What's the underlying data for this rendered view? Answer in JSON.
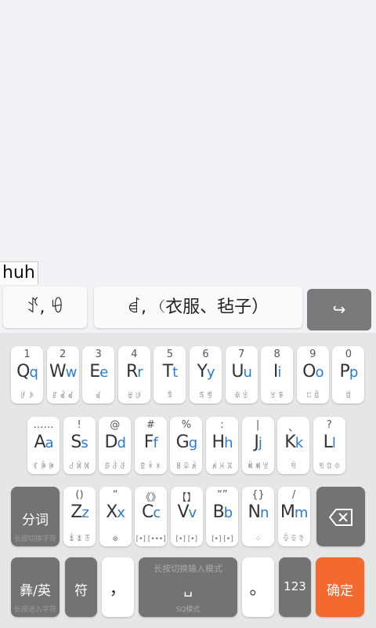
{
  "composing": "huh",
  "candidates": [
    "ꀋ, ꀺ",
    "ꀸ, （衣服、毡子）"
  ],
  "expand_symbol": "↪",
  "rows": {
    "row1": [
      {
        "sym": "1",
        "up": "Q",
        "lo": "q",
        "yi": "ꀱ ꀲ"
      },
      {
        "sym": "2",
        "up": "W",
        "lo": "w",
        "yi": "ꀵ ꀶ ꀷ"
      },
      {
        "sym": "3",
        "up": "E",
        "lo": "e",
        "yi": "ꀸ"
      },
      {
        "sym": "4",
        "up": "R",
        "lo": "r",
        "yi": "ꁁ ꁂ"
      },
      {
        "sym": "5",
        "up": "T",
        "lo": "t",
        "yi": "ꁃ"
      },
      {
        "sym": "6",
        "up": "Y",
        "lo": "y",
        "yi": "ꁄ ꁅ"
      },
      {
        "sym": "7",
        "up": "U",
        "lo": "u",
        "yi": "ꁆ ꁇ"
      },
      {
        "sym": "8",
        "up": "I",
        "lo": "i",
        "yi": "ꁈ ꁉ"
      },
      {
        "sym": "9",
        "up": "O",
        "lo": "o",
        "yi": "ꁊ ꁋ"
      },
      {
        "sym": "0",
        "up": "P",
        "lo": "p",
        "yi": "ꁌ"
      }
    ],
    "row2": [
      {
        "sym": "……",
        "up": "A",
        "lo": "a",
        "yi": "ꁍ ꁎ ꁏ"
      },
      {
        "sym": "!",
        "up": "S",
        "lo": "s",
        "yi": "ꁐ ꁑ ꁒ"
      },
      {
        "sym": "@",
        "up": "D",
        "lo": "d",
        "yi": "ꁓ ꁔ ꁕ"
      },
      {
        "sym": "#",
        "up": "F",
        "lo": "f",
        "yi": "ꁖ ꁗ ꁘ"
      },
      {
        "sym": "%",
        "up": "G",
        "lo": "g",
        "yi": "ꁙ ꁚ ꁛ"
      },
      {
        "sym": ":",
        "up": "H",
        "lo": "h",
        "yi": "ꁜ ꁝ ꁞ"
      },
      {
        "sym": "|",
        "up": "J",
        "lo": "j",
        "yi": "ꁟ ꁠ ꁡ"
      },
      {
        "sym": "、",
        "up": "K",
        "lo": "k",
        "yi": "ꁢ"
      },
      {
        "sym": "?",
        "up": "L",
        "lo": "l",
        "yi": "ꁣ ꁤ ꁥ"
      }
    ],
    "row3": [
      {
        "sym": "()",
        "up": "Z",
        "lo": "z",
        "yi": "ꁦ ꁧ ꁨ"
      },
      {
        "sym": "“",
        "up": "X",
        "lo": "x",
        "yi": "⊗"
      },
      {
        "sym": "《》",
        "up": "C",
        "lo": "c",
        "yi": "[•] [•••]"
      },
      {
        "sym": "【】",
        "up": "V",
        "lo": "v",
        "yi": "[•] [•]"
      },
      {
        "sym": "“”",
        "up": "B",
        "lo": "b",
        "yi": "[•] [•]"
      },
      {
        "sym": "{}",
        "up": "N",
        "lo": "n",
        "yi": "⁘"
      },
      {
        "sym": "/",
        "up": "M",
        "lo": "m",
        "yi": "ꁩ ꁪ ꁫ"
      }
    ]
  },
  "func": {
    "fenci": "分词",
    "fenci_sub": "长按切换字符",
    "yi_en": "彝/英",
    "yi_en_sub": "长按进入字符",
    "fu": "符",
    "comma": "，",
    "space_top": "长按切换输入模式",
    "space_mid": "␣",
    "space_bot": "SQ模式",
    "period": "。",
    "num": "123",
    "confirm": "确定"
  },
  "colors": {
    "accent": "#2a7bd0",
    "dark_key": "#737373",
    "confirm": "#f46a2e"
  }
}
